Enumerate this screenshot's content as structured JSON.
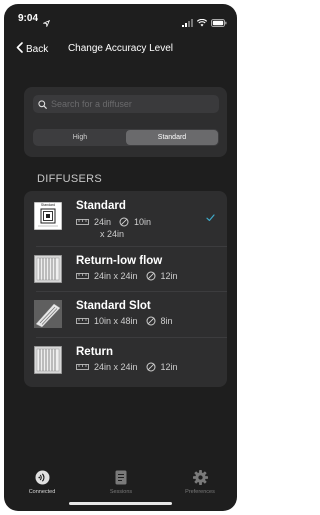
{
  "status_bar": {
    "time": "9:04"
  },
  "nav": {
    "back_label": "Back",
    "title": "Change Accuracy Level"
  },
  "search": {
    "placeholder": "Search for a diffuser"
  },
  "segments": [
    {
      "label": "High",
      "selected": false
    },
    {
      "label": "Standard",
      "selected": true
    }
  ],
  "section": {
    "label": "DIFFUSERS"
  },
  "diffusers": [
    {
      "name": "Standard",
      "size": "24in",
      "size_line2": "x 24in",
      "neck": "10in",
      "selected": true,
      "thumb_label": "Standard"
    },
    {
      "name": "Return-low flow",
      "size": "24in x 24in",
      "neck": "12in",
      "selected": false
    },
    {
      "name": "Standard Slot",
      "size": "10in x 48in",
      "neck": "8in",
      "selected": false
    },
    {
      "name": "Return",
      "size": "24in x 24in",
      "neck": "12in",
      "selected": false
    }
  ],
  "tabs": [
    {
      "label": "Connected",
      "icon": "connected-icon",
      "active": true
    },
    {
      "label": "Sessions",
      "icon": "document-icon",
      "active": false
    },
    {
      "label": "Preferences",
      "icon": "gear-icon",
      "active": false
    }
  ],
  "colors": {
    "background": "#1e1e1e",
    "card": "#2e2e2f",
    "accent": "#3fa9c8",
    "segment_active": "#6a6a6c"
  }
}
